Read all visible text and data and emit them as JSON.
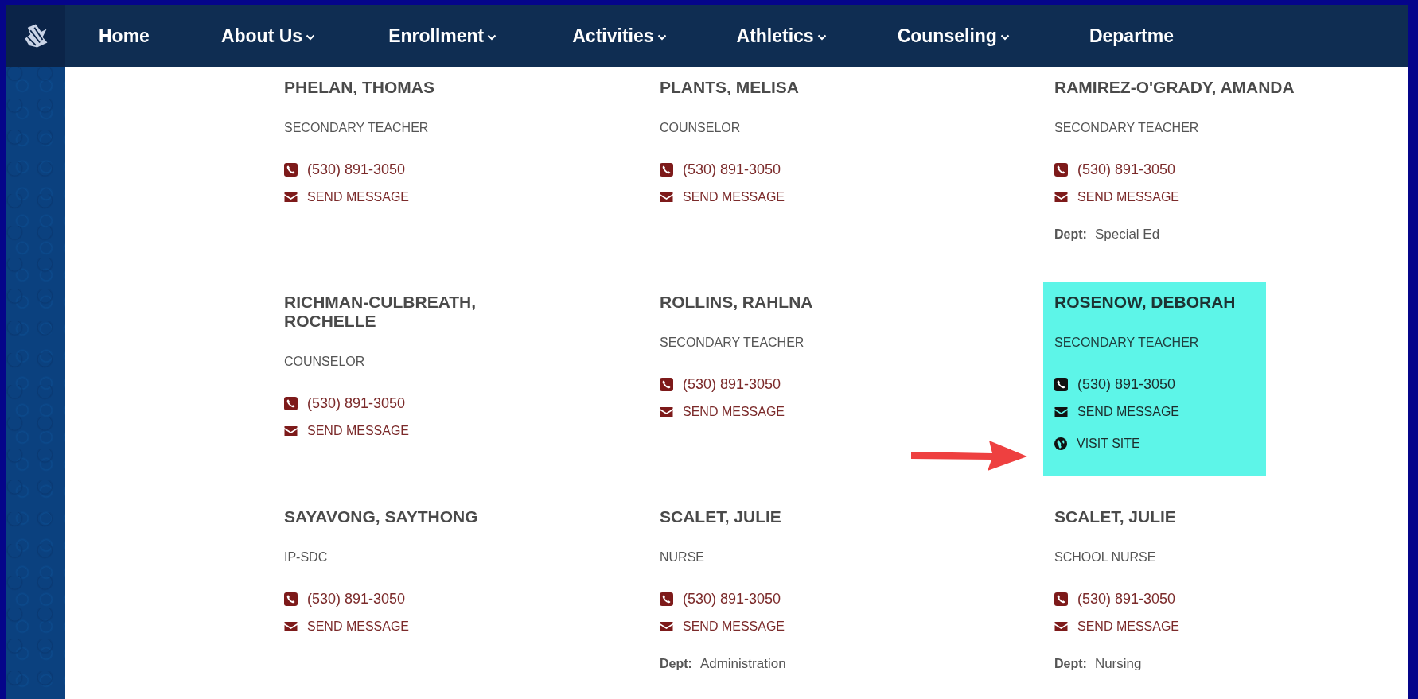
{
  "nav": {
    "items": [
      {
        "label": "Home",
        "has_menu": false
      },
      {
        "label": "About Us",
        "has_menu": true
      },
      {
        "label": "Enrollment",
        "has_menu": true
      },
      {
        "label": "Activities",
        "has_menu": true
      },
      {
        "label": "Athletics",
        "has_menu": true
      },
      {
        "label": "Counseling",
        "has_menu": true
      },
      {
        "label": "Departme",
        "has_menu": false
      }
    ]
  },
  "staff": [
    {
      "name": "PHELAN, THOMAS",
      "title": "SECONDARY TEACHER",
      "phone": "(530) 891-3050",
      "message": "SEND MESSAGE",
      "highlighted": false
    },
    {
      "name": "PLANTS, MELISA",
      "title": "COUNSELOR",
      "phone": "(530) 891-3050",
      "message": "SEND MESSAGE",
      "highlighted": false
    },
    {
      "name": "RAMIREZ-O'GRADY, AMANDA",
      "title": "SECONDARY TEACHER",
      "phone": "(530) 891-3050",
      "message": "SEND MESSAGE",
      "dept_label": "Dept:",
      "dept": "Special Ed",
      "highlighted": false
    },
    {
      "name": "RICHMAN-CULBREATH, ROCHELLE",
      "title": "COUNSELOR",
      "phone": "(530) 891-3050",
      "message": "SEND MESSAGE",
      "highlighted": false
    },
    {
      "name": "ROLLINS, RAHLNA",
      "title": "SECONDARY TEACHER",
      "phone": "(530) 891-3050",
      "message": "SEND MESSAGE",
      "highlighted": false
    },
    {
      "name": "ROSENOW, DEBORAH",
      "title": "SECONDARY TEACHER",
      "phone": "(530) 891-3050",
      "message": "SEND MESSAGE",
      "site": "VISIT SITE",
      "highlighted": true
    },
    {
      "name": "SAYAVONG, SAYTHONG",
      "title": "IP-SDC",
      "phone": "(530) 891-3050",
      "message": "SEND MESSAGE",
      "highlighted": false
    },
    {
      "name": "SCALET, JULIE",
      "title": "NURSE",
      "phone": "(530) 891-3050",
      "message": "SEND MESSAGE",
      "dept_label": "Dept:",
      "dept": "Administration",
      "highlighted": false
    },
    {
      "name": "SCALET, JULIE",
      "title": "SCHOOL NURSE",
      "phone": "(530) 891-3050",
      "message": "SEND MESSAGE",
      "dept_label": "Dept:",
      "dept": "Nursing",
      "highlighted": false
    }
  ]
}
